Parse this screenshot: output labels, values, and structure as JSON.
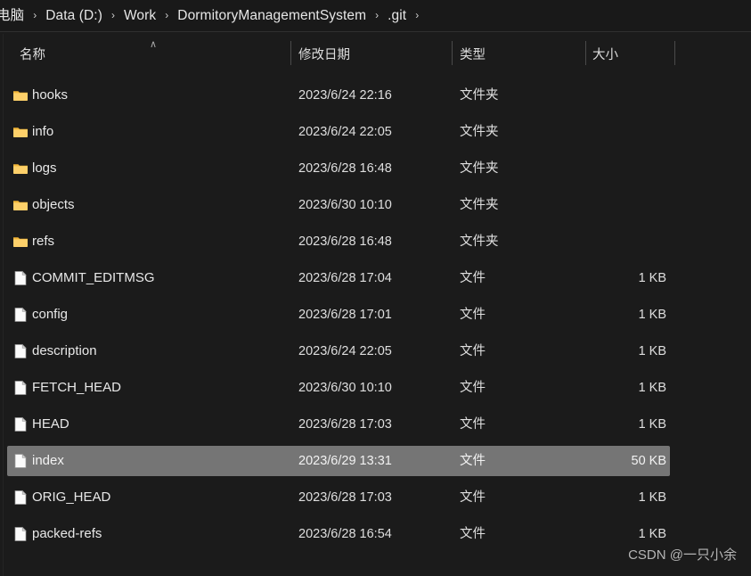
{
  "window": {
    "background_color": "#1b1b1b",
    "selection_color": "#757575"
  },
  "breadcrumb": {
    "name": "address-breadcrumb",
    "separator": "›",
    "items": [
      {
        "label": "电脑"
      },
      {
        "label": "Data (D:)"
      },
      {
        "label": "Work"
      },
      {
        "label": "DormitoryManagementSystem"
      },
      {
        "label": ".git"
      }
    ]
  },
  "columns": {
    "name": "名称",
    "date_modified": "修改日期",
    "type": "类型",
    "size": "大小",
    "sort_indicator": "∧",
    "sort_column": "名称",
    "sort_direction": "ascending"
  },
  "files": [
    {
      "name": "hooks",
      "date": "2023/6/24 22:16",
      "type": "文件夹",
      "size": "",
      "kind": "folder",
      "selected": false
    },
    {
      "name": "info",
      "date": "2023/6/24 22:05",
      "type": "文件夹",
      "size": "",
      "kind": "folder",
      "selected": false
    },
    {
      "name": "logs",
      "date": "2023/6/28 16:48",
      "type": "文件夹",
      "size": "",
      "kind": "folder",
      "selected": false
    },
    {
      "name": "objects",
      "date": "2023/6/30 10:10",
      "type": "文件夹",
      "size": "",
      "kind": "folder",
      "selected": false
    },
    {
      "name": "refs",
      "date": "2023/6/28 16:48",
      "type": "文件夹",
      "size": "",
      "kind": "folder",
      "selected": false
    },
    {
      "name": "COMMIT_EDITMSG",
      "date": "2023/6/28 17:04",
      "type": "文件",
      "size": "1 KB",
      "kind": "file",
      "selected": false
    },
    {
      "name": "config",
      "date": "2023/6/28 17:01",
      "type": "文件",
      "size": "1 KB",
      "kind": "file",
      "selected": false
    },
    {
      "name": "description",
      "date": "2023/6/24 22:05",
      "type": "文件",
      "size": "1 KB",
      "kind": "file",
      "selected": false
    },
    {
      "name": "FETCH_HEAD",
      "date": "2023/6/30 10:10",
      "type": "文件",
      "size": "1 KB",
      "kind": "file",
      "selected": false
    },
    {
      "name": "HEAD",
      "date": "2023/6/28 17:03",
      "type": "文件",
      "size": "1 KB",
      "kind": "file",
      "selected": false
    },
    {
      "name": "index",
      "date": "2023/6/29 13:31",
      "type": "文件",
      "size": "50 KB",
      "kind": "file",
      "selected": true
    },
    {
      "name": "ORIG_HEAD",
      "date": "2023/6/28 17:03",
      "type": "文件",
      "size": "1 KB",
      "kind": "file",
      "selected": false
    },
    {
      "name": "packed-refs",
      "date": "2023/6/28 16:54",
      "type": "文件",
      "size": "1 KB",
      "kind": "file",
      "selected": false
    }
  ],
  "watermark": {
    "text": "CSDN @一只小余"
  }
}
